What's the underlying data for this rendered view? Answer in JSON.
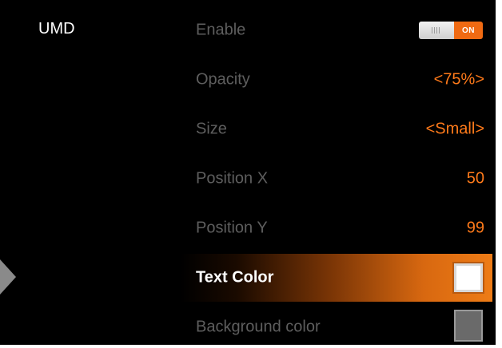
{
  "section": {
    "title": "UMD"
  },
  "menu": {
    "items": [
      {
        "label": "Enable",
        "toggle_state": "ON"
      },
      {
        "label": "Opacity",
        "value": "<75%>"
      },
      {
        "label": "Size",
        "value": "<Small>"
      },
      {
        "label": "Position X",
        "value": "50"
      },
      {
        "label": "Position Y",
        "value": "99"
      },
      {
        "label": "Text Color",
        "swatch_color": "#ffffff"
      },
      {
        "label": "Background color",
        "swatch_color": "#6a6a6a"
      }
    ]
  },
  "colors": {
    "accent": "#ff7a1a",
    "label_dim": "#5e5e5e",
    "background": "#000000"
  }
}
